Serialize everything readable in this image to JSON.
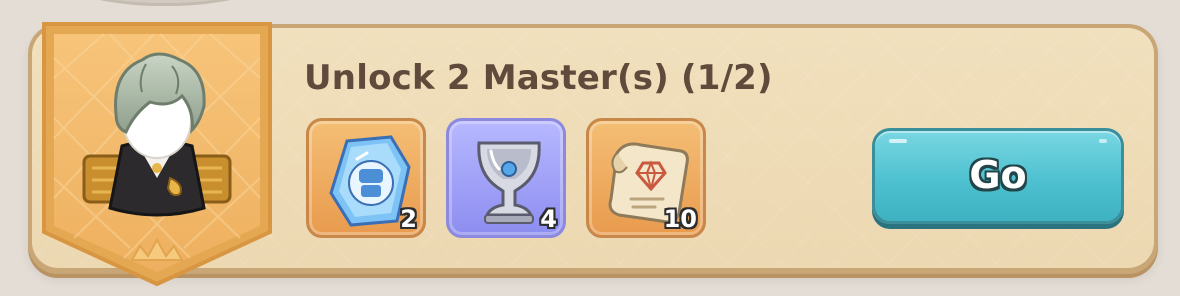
{
  "quest": {
    "title": "Unlock 2 Master(s) (1/2)",
    "rewards": [
      {
        "icon": "blue-crystal-token-icon",
        "quantity": "2",
        "frame_color": "#eea45b"
      },
      {
        "icon": "silver-goblet-icon",
        "quantity": "4",
        "frame_color": "#9b9cf7"
      },
      {
        "icon": "gem-scroll-icon",
        "quantity": "10",
        "frame_color": "#eea45b"
      }
    ],
    "action_label": "Go"
  },
  "colors": {
    "card_background": "#efdcb8",
    "banner_gold": "#f0b965",
    "title_text": "#5f4a3b",
    "go_button": "#4ec1d0"
  },
  "portrait": {
    "icon": "master-character-portrait"
  }
}
